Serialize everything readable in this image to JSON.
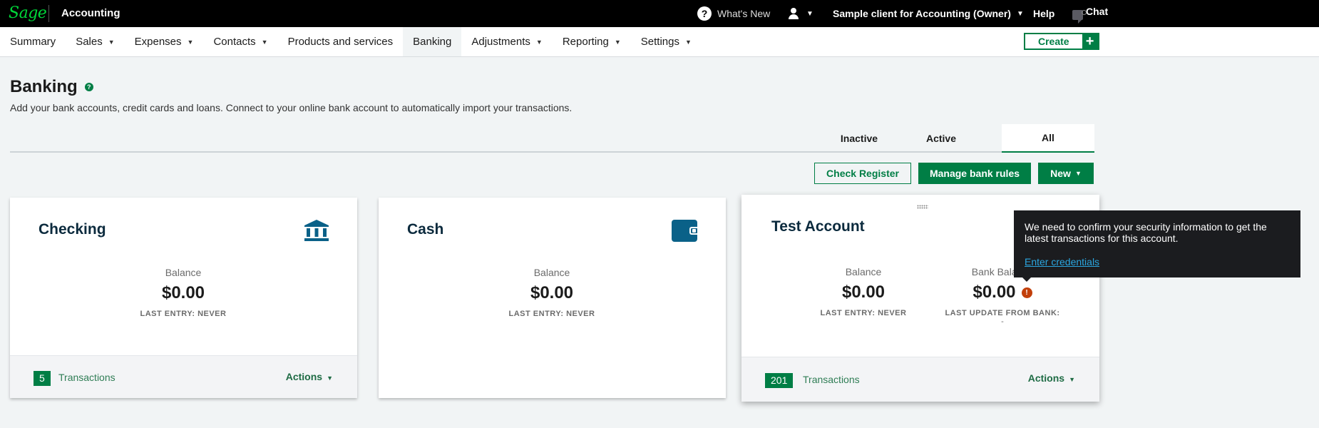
{
  "topbar": {
    "logo": "Sage",
    "app_name": "Accounting",
    "whats_new": "What's New",
    "client": "Sample client for Accounting (Owner)",
    "help": "Help",
    "chat": "Chat"
  },
  "nav": {
    "items": [
      {
        "label": "Summary",
        "dropdown": false
      },
      {
        "label": "Sales",
        "dropdown": true
      },
      {
        "label": "Expenses",
        "dropdown": true
      },
      {
        "label": "Contacts",
        "dropdown": true
      },
      {
        "label": "Products and services",
        "dropdown": false
      },
      {
        "label": "Banking",
        "dropdown": false,
        "active": true
      },
      {
        "label": "Adjustments",
        "dropdown": true
      },
      {
        "label": "Reporting",
        "dropdown": true
      },
      {
        "label": "Settings",
        "dropdown": true
      }
    ],
    "create_label": "Create"
  },
  "page": {
    "title": "Banking",
    "subtitle": "Add your bank accounts, credit cards and loans. Connect to your online bank account to automatically import your transactions."
  },
  "tabs": {
    "inactive": "Inactive",
    "active": "Active",
    "all": "All",
    "selected": "All"
  },
  "buttons": {
    "check_register": "Check Register",
    "manage_bank_rules": "Manage bank rules",
    "new": "New"
  },
  "accounts": [
    {
      "name": "Checking",
      "icon": "bank-icon",
      "balance_label": "Balance",
      "balance": "$0.00",
      "last_entry": "LAST ENTRY: NEVER",
      "transactions_count": "5",
      "transactions_label": "Transactions",
      "actions_label": "Actions"
    },
    {
      "name": "Cash",
      "icon": "wallet-icon",
      "balance_label": "Balance",
      "balance": "$0.00",
      "last_entry": "LAST ENTRY: NEVER"
    },
    {
      "name": "Test Account",
      "balance_label": "Balance",
      "balance": "$0.00",
      "last_entry": "LAST ENTRY: NEVER",
      "bank_balance_label": "Bank Balance",
      "bank_balance": "$0.00",
      "last_update_label": "LAST UPDATE FROM BANK:",
      "last_update_value": "-",
      "transactions_count": "201",
      "transactions_label": "Transactions",
      "actions_label": "Actions"
    }
  ],
  "tooltip": {
    "message": "We need to confirm your security information to get the latest transactions for this account.",
    "link": "Enter credentials"
  },
  "colors": {
    "brand_green": "#007e45",
    "logo_green": "#00d639",
    "icon_blue": "#0a6188",
    "warning": "#c23f0a",
    "link_blue": "#2ba6e0"
  }
}
